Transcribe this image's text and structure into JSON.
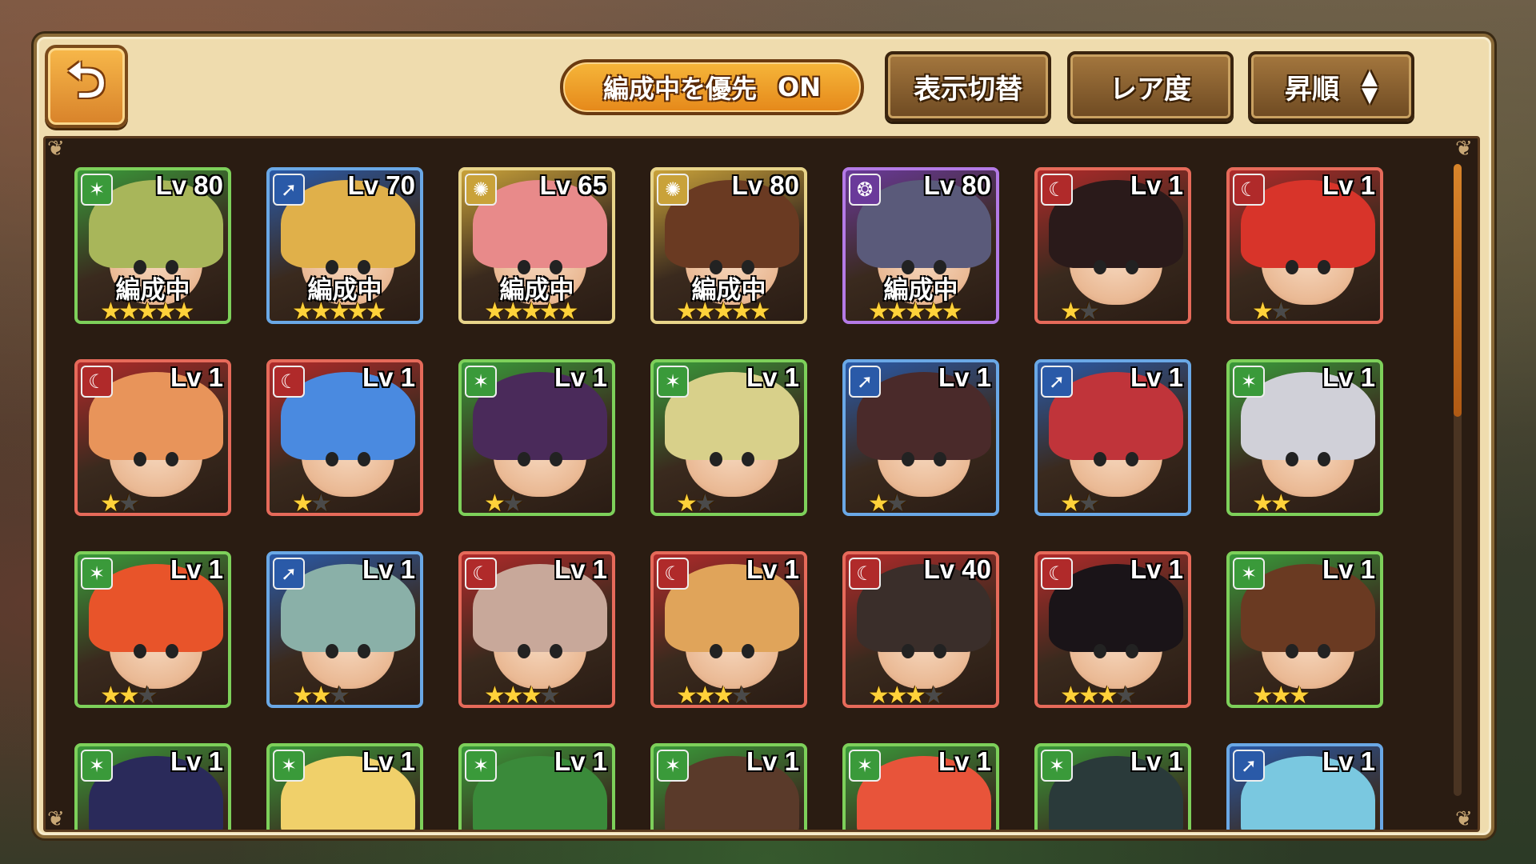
{
  "header": {
    "back_icon": "return-arrow-icon",
    "back_glyph": "⮌",
    "priority_label": "編成中を優先",
    "priority_state": "ON",
    "display_toggle_label": "表示切替",
    "rarity_label": "レア度",
    "sort_order_label": "昇順",
    "sort_arrow_up": "▲",
    "sort_arrow_down": "▼"
  },
  "scroll": {
    "position_fraction": 0.0,
    "visible_fraction": 0.4
  },
  "element_icons": {
    "wind": {
      "glyph": "✶",
      "color": "#3a9a3a",
      "border": "#7dd05a"
    },
    "water": {
      "glyph": "➚",
      "color": "#2a5aa8",
      "border": "#6aa8e6"
    },
    "light": {
      "glyph": "✺",
      "color": "#c9a23a",
      "border": "#e8d48a"
    },
    "dark": {
      "glyph": "❂",
      "color": "#6a3a9a",
      "border": "#b47ae6"
    },
    "fire": {
      "glyph": "☾",
      "color": "#b02a2a",
      "border": "#e66a5a"
    }
  },
  "units": [
    {
      "element": "wind",
      "level": "Lv 80",
      "deployed": "編成中",
      "stars": 5,
      "max_stars": 5,
      "hair": "#a8b65a"
    },
    {
      "element": "water",
      "level": "Lv 70",
      "deployed": "編成中",
      "stars": 5,
      "max_stars": 5,
      "hair": "#e0b04a"
    },
    {
      "element": "light",
      "level": "Lv 65",
      "deployed": "編成中",
      "stars": 5,
      "max_stars": 5,
      "hair": "#e88a8a"
    },
    {
      "element": "light",
      "level": "Lv 80",
      "deployed": "編成中",
      "stars": 5,
      "max_stars": 5,
      "hair": "#6a3a22"
    },
    {
      "element": "dark",
      "level": "Lv 80",
      "deployed": "編成中",
      "stars": 5,
      "max_stars": 5,
      "hair": "#5a5a7a"
    },
    {
      "element": "fire",
      "level": "Lv 1",
      "deployed": "",
      "stars": 1,
      "max_stars": 2,
      "hair": "#2a1a1a"
    },
    {
      "element": "fire",
      "level": "Lv 1",
      "deployed": "",
      "stars": 1,
      "max_stars": 2,
      "hair": "#d8342a"
    },
    {
      "element": "fire",
      "level": "Lv 1",
      "deployed": "",
      "stars": 1,
      "max_stars": 2,
      "hair": "#e8945a"
    },
    {
      "element": "fire",
      "level": "Lv 1",
      "deployed": "",
      "stars": 1,
      "max_stars": 2,
      "hair": "#4a8ae0"
    },
    {
      "element": "wind",
      "level": "Lv 1",
      "deployed": "",
      "stars": 1,
      "max_stars": 2,
      "hair": "#4a2a5a"
    },
    {
      "element": "wind",
      "level": "Lv 1",
      "deployed": "",
      "stars": 1,
      "max_stars": 2,
      "hair": "#d8d08a"
    },
    {
      "element": "water",
      "level": "Lv 1",
      "deployed": "",
      "stars": 1,
      "max_stars": 2,
      "hair": "#4a2a2a"
    },
    {
      "element": "water",
      "level": "Lv 1",
      "deployed": "",
      "stars": 1,
      "max_stars": 2,
      "hair": "#c0343a"
    },
    {
      "element": "wind",
      "level": "Lv 1",
      "deployed": "",
      "stars": 2,
      "max_stars": 2,
      "hair": "#d0d0d8"
    },
    {
      "element": "wind",
      "level": "Lv 1",
      "deployed": "",
      "stars": 2,
      "max_stars": 3,
      "hair": "#e8542a"
    },
    {
      "element": "water",
      "level": "Lv 1",
      "deployed": "",
      "stars": 2,
      "max_stars": 3,
      "hair": "#8ab0a8"
    },
    {
      "element": "fire",
      "level": "Lv 1",
      "deployed": "",
      "stars": 3,
      "max_stars": 4,
      "hair": "#c8a89a"
    },
    {
      "element": "fire",
      "level": "Lv 1",
      "deployed": "",
      "stars": 3,
      "max_stars": 4,
      "hair": "#e0a45a"
    },
    {
      "element": "fire",
      "level": "Lv 40",
      "deployed": "",
      "stars": 3,
      "max_stars": 4,
      "hair": "#3a2e2a"
    },
    {
      "element": "fire",
      "level": "Lv 1",
      "deployed": "",
      "stars": 3,
      "max_stars": 4,
      "hair": "#1a1418"
    },
    {
      "element": "wind",
      "level": "Lv 1",
      "deployed": "",
      "stars": 3,
      "max_stars": 3,
      "hair": "#6a3a22"
    },
    {
      "element": "wind",
      "level": "Lv 1",
      "deployed": "",
      "stars": 0,
      "max_stars": 0,
      "hair": "#2a2a5a"
    },
    {
      "element": "wind",
      "level": "Lv 1",
      "deployed": "",
      "stars": 0,
      "max_stars": 0,
      "hair": "#f0d06a"
    },
    {
      "element": "wind",
      "level": "Lv 1",
      "deployed": "",
      "stars": 0,
      "max_stars": 0,
      "hair": "#3a8a3a"
    },
    {
      "element": "wind",
      "level": "Lv 1",
      "deployed": "",
      "stars": 0,
      "max_stars": 0,
      "hair": "#5a3a2a"
    },
    {
      "element": "wind",
      "level": "Lv 1",
      "deployed": "",
      "stars": 0,
      "max_stars": 0,
      "hair": "#e8543a"
    },
    {
      "element": "wind",
      "level": "Lv 1",
      "deployed": "",
      "stars": 0,
      "max_stars": 0,
      "hair": "#2a3a3a"
    },
    {
      "element": "water",
      "level": "Lv 1",
      "deployed": "",
      "stars": 0,
      "max_stars": 0,
      "hair": "#7ac8e0"
    }
  ]
}
